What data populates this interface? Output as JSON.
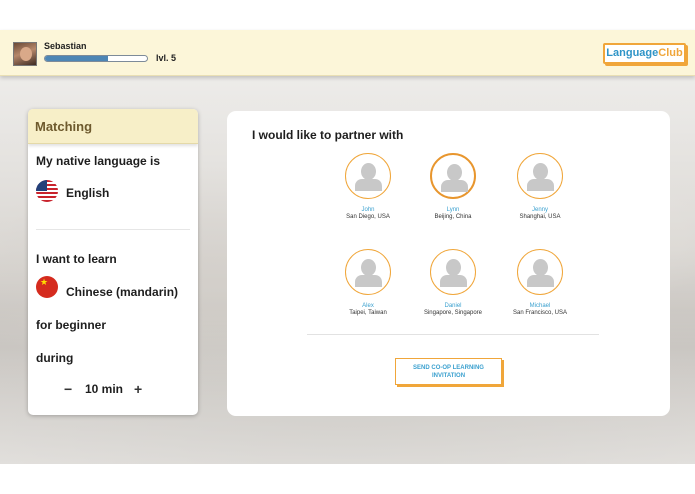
{
  "header": {
    "user_name": "Sebastian",
    "level_label": "lvl. 5",
    "progress": 0.62,
    "logo_part1": "Language",
    "logo_part2": "Club"
  },
  "matching": {
    "tab_title": "Matching",
    "native_label": "My native language is",
    "native_language": "English",
    "native_flag": "us-flag-icon",
    "learn_label": "I want to learn",
    "learn_language": "Chinese (mandarin)",
    "learn_flag": "china-flag-icon",
    "level_text": "for beginner",
    "during_label": "during",
    "duration": "10 min",
    "minus_symbol": "−",
    "plus_symbol": "+"
  },
  "partners": {
    "title": "I would like to partner with",
    "items": [
      {
        "name": "John",
        "location": "San Diego, USA",
        "selected": false
      },
      {
        "name": "Lynn",
        "location": "Beijing, China",
        "selected": true
      },
      {
        "name": "Jenny",
        "location": "Shanghai, USA",
        "selected": false
      },
      {
        "name": "Alex",
        "location": "Taipei, Taiwan",
        "selected": false
      },
      {
        "name": "Daniel",
        "location": "Singapore, Singapore",
        "selected": false
      },
      {
        "name": "Michael",
        "location": "San Francisco, USA",
        "selected": false
      }
    ],
    "invite_button": "SEND CO-OP LEARNING INVITATION"
  },
  "colors": {
    "accent_orange": "#f0a63a",
    "accent_blue": "#3aa0cf",
    "header_bg": "#fcf6d9"
  }
}
